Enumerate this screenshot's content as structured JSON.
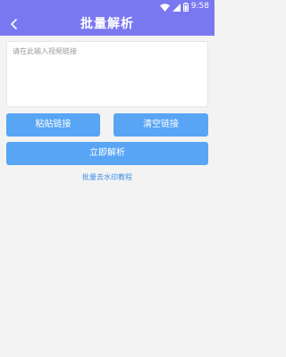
{
  "status_bar": {
    "time": "9:58",
    "icons": [
      "wifi-icon",
      "signal-icon",
      "battery-icon"
    ]
  },
  "app_bar": {
    "title": "批量解析",
    "back_icon": "back-arrow-icon"
  },
  "input": {
    "placeholder": "请在此输入视频链接",
    "value": ""
  },
  "buttons": {
    "paste": "粘贴链接",
    "clear": "清空链接",
    "parse": "立即解析"
  },
  "links": {
    "tutorial": "批量去水印教程"
  },
  "colors": {
    "header": "#7a78f0",
    "button": "#58a5f5",
    "link": "#3d8fe6",
    "background": "#f3f3f3"
  }
}
